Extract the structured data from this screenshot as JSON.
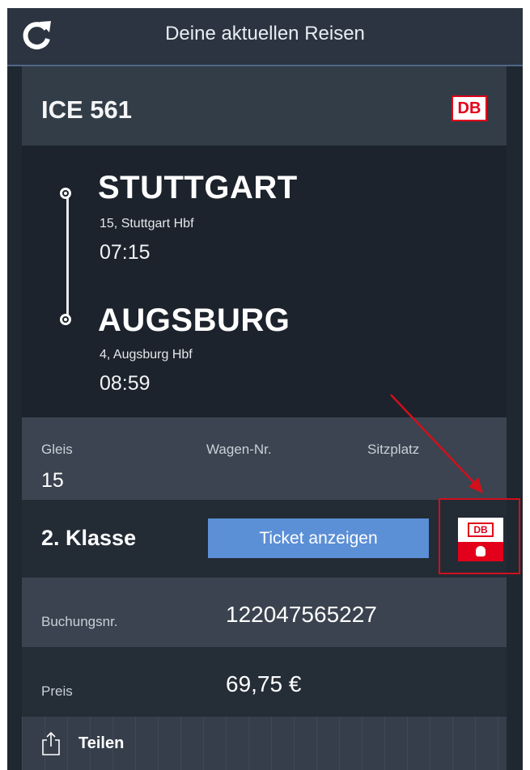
{
  "header": {
    "title": "Deine aktuellen Reisen"
  },
  "trip": {
    "train": "ICE 561",
    "logo": "DB",
    "departure": {
      "station": "STUTTGART",
      "platform": "15, Stuttgart Hbf",
      "time": "07:15"
    },
    "arrival": {
      "station": "AUGSBURG",
      "platform": "4, Augsburg Hbf",
      "time": "08:59"
    },
    "info": {
      "gleis_label": "Gleis",
      "gleis_value": "15",
      "wagen_label": "Wagen-Nr.",
      "sitzplatz_label": "Sitzplatz"
    },
    "klasse": "2. Klasse",
    "ticket_button": "Ticket anzeigen",
    "booking": {
      "label": "Buchungsnr.",
      "value": "122047565227"
    },
    "price": {
      "label": "Preis",
      "value": "69,75 €"
    },
    "share": {
      "label": "Teilen"
    }
  },
  "icons": {
    "refresh": "refresh-icon",
    "share": "share-icon",
    "db_navigator": "db-navigator-icon"
  },
  "colors": {
    "db_red": "#e2001a",
    "button_blue": "#5b8fd6",
    "annotation_red": "#d0101c"
  }
}
